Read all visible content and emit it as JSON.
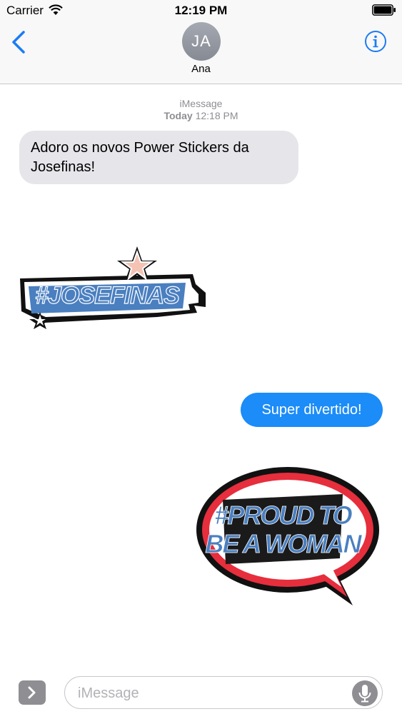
{
  "status_bar": {
    "carrier": "Carrier",
    "time": "12:19 PM"
  },
  "header": {
    "avatar_initials": "JA",
    "contact_name": "Ana"
  },
  "thread": {
    "service": "iMessage",
    "timestamp_day": "Today",
    "timestamp_time": "12:18 PM",
    "messages": [
      {
        "direction": "incoming",
        "text": "Adoro os novos Power Stickers da Josefinas!"
      },
      {
        "direction": "incoming",
        "sticker": "#JOSEFINAS"
      },
      {
        "direction": "outgoing",
        "text": "Super divertido!"
      },
      {
        "direction": "outgoing",
        "sticker": "#PROUD TO BE A WOMAN"
      }
    ]
  },
  "stickers": {
    "josefinas": "#JOSEFINAS",
    "proud_line1": "#PROUD TO",
    "proud_line2": "BE A WOMAN"
  },
  "composer": {
    "placeholder": "iMessage"
  },
  "colors": {
    "accent": "#1b7cf5",
    "outgoing_bubble": "#1b8cf8",
    "incoming_bubble": "#e5e5ea",
    "sticker_blue": "#4a7fc0",
    "sticker_red": "#e62e3c"
  }
}
